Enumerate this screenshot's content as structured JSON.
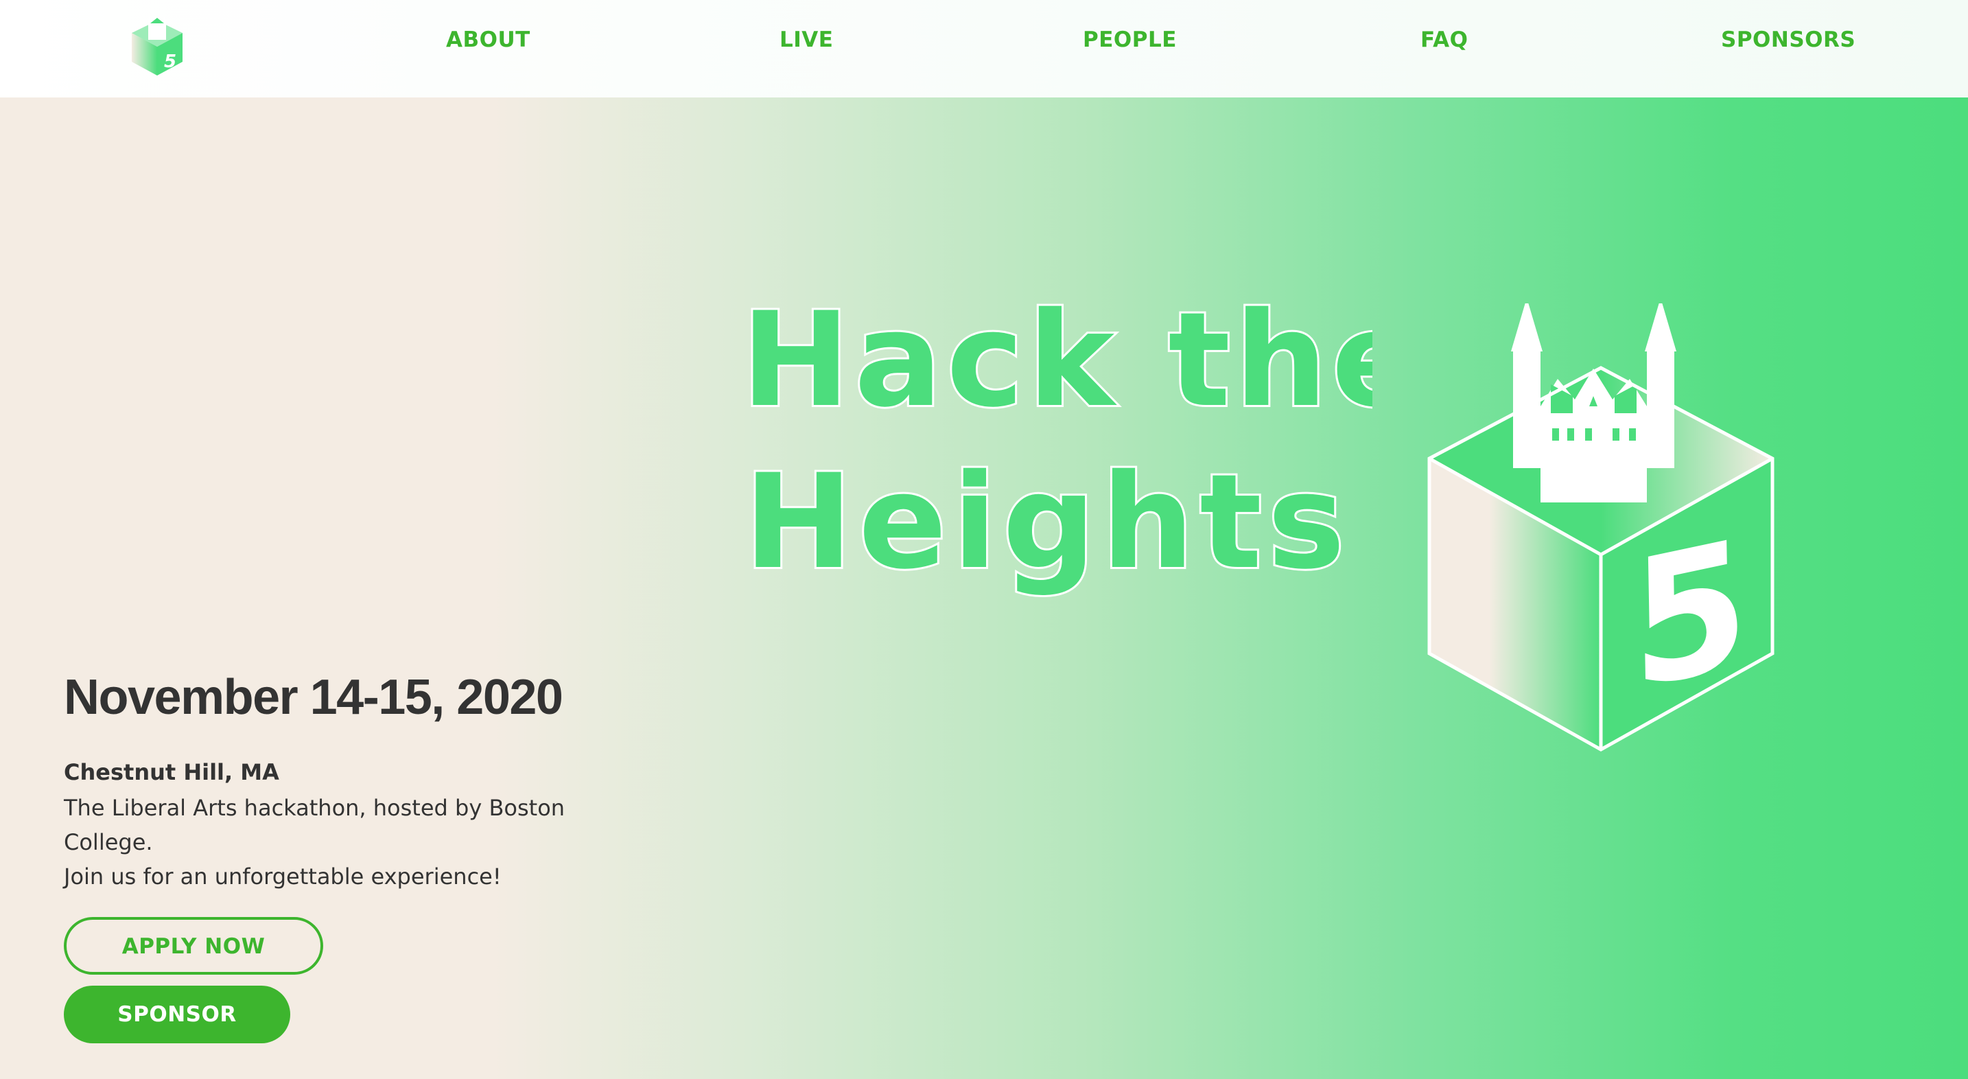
{
  "nav": {
    "logo_number": "5",
    "links": [
      {
        "label": "ABOUT"
      },
      {
        "label": "LIVE"
      },
      {
        "label": "PEOPLE"
      },
      {
        "label": "FAQ"
      },
      {
        "label": "SPONSORS"
      }
    ]
  },
  "hero": {
    "title_line1": "Hack the",
    "title_line2": "Heights",
    "cube_number": "5",
    "date": "November 14-15, 2020",
    "location": "Chestnut Hill, MA",
    "description_line1": "The Liberal Arts hackathon, hosted by Boston College.",
    "description_line2": "Join us for an unforgettable experience!",
    "apply_label": "APPLY NOW",
    "sponsor_label": "SPONSOR"
  },
  "colors": {
    "accent_green": "#3db52e",
    "bright_green": "#4cdd7d",
    "cream": "#f4ece3",
    "dark_text": "#333333"
  }
}
